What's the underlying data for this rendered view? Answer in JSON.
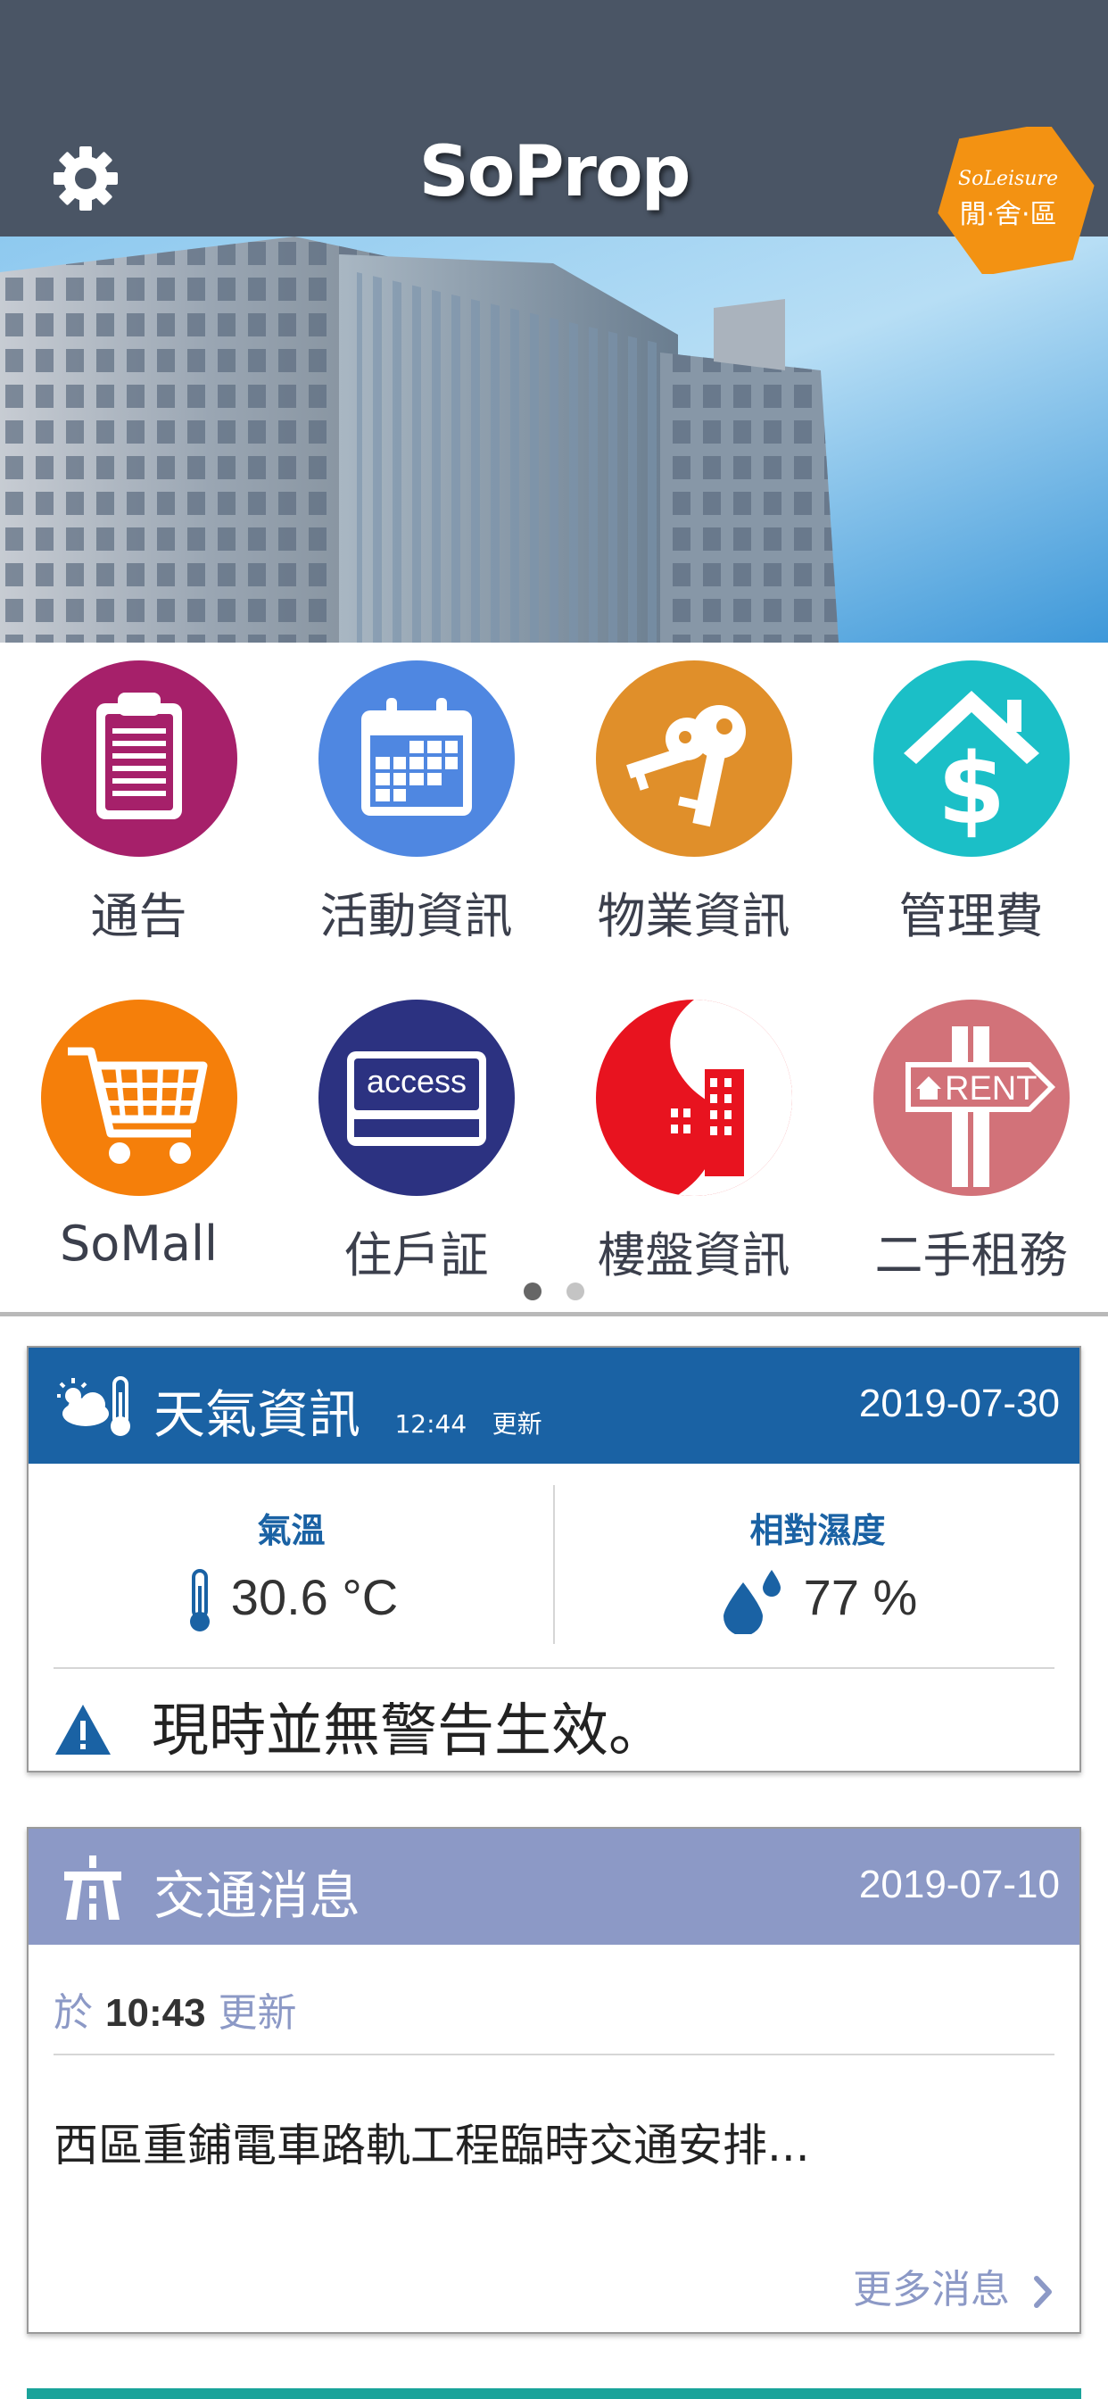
{
  "app": {
    "logo_text": "SoProp",
    "badge": {
      "line1": "SoLeisure",
      "line2": "閒·舍·區",
      "color": "#f39212"
    },
    "header_color": "#4a5565"
  },
  "menu": {
    "items": [
      {
        "label": "通告",
        "icon": "clipboard-icon",
        "color": "#a6206a"
      },
      {
        "label": "活動資訊",
        "icon": "calendar-icon",
        "color": "#4f87e1"
      },
      {
        "label": "物業資訊",
        "icon": "keys-icon",
        "color": "#e08f2a"
      },
      {
        "label": "管理費",
        "icon": "house-dollar-icon",
        "color": "#1bbfc7"
      },
      {
        "label": "SoMall",
        "icon": "cart-icon",
        "color": "#f57f0a"
      },
      {
        "label": "住戶証",
        "icon": "access-card-icon",
        "color": "#2c3281",
        "card_text": "access"
      },
      {
        "label": "樓盤資訊",
        "icon": "building-icon",
        "color": "#e8131f"
      },
      {
        "label": "二手租務",
        "icon": "rent-sign-icon",
        "color": "#d27279",
        "sign_text": "RENT"
      }
    ],
    "pages": 2,
    "active_page": 1
  },
  "weather": {
    "title": "天氣資訊",
    "update_time": "12:44",
    "update_word": "更新",
    "date": "2019-07-30",
    "temperature": {
      "label": "氣溫",
      "value": "30.6 °C"
    },
    "humidity": {
      "label": "相對濕度",
      "value": "77 %"
    },
    "warning": "現時並無警告生效。",
    "color": "#1a62a4"
  },
  "traffic": {
    "title": "交通消息",
    "date": "2019-07-10",
    "prefix": "於",
    "time": "10:43",
    "update_word": "更新",
    "headline": "西區重鋪電車路軌工程臨時交通安排...",
    "more_label": "更多消息",
    "color": "#8c99c6"
  }
}
